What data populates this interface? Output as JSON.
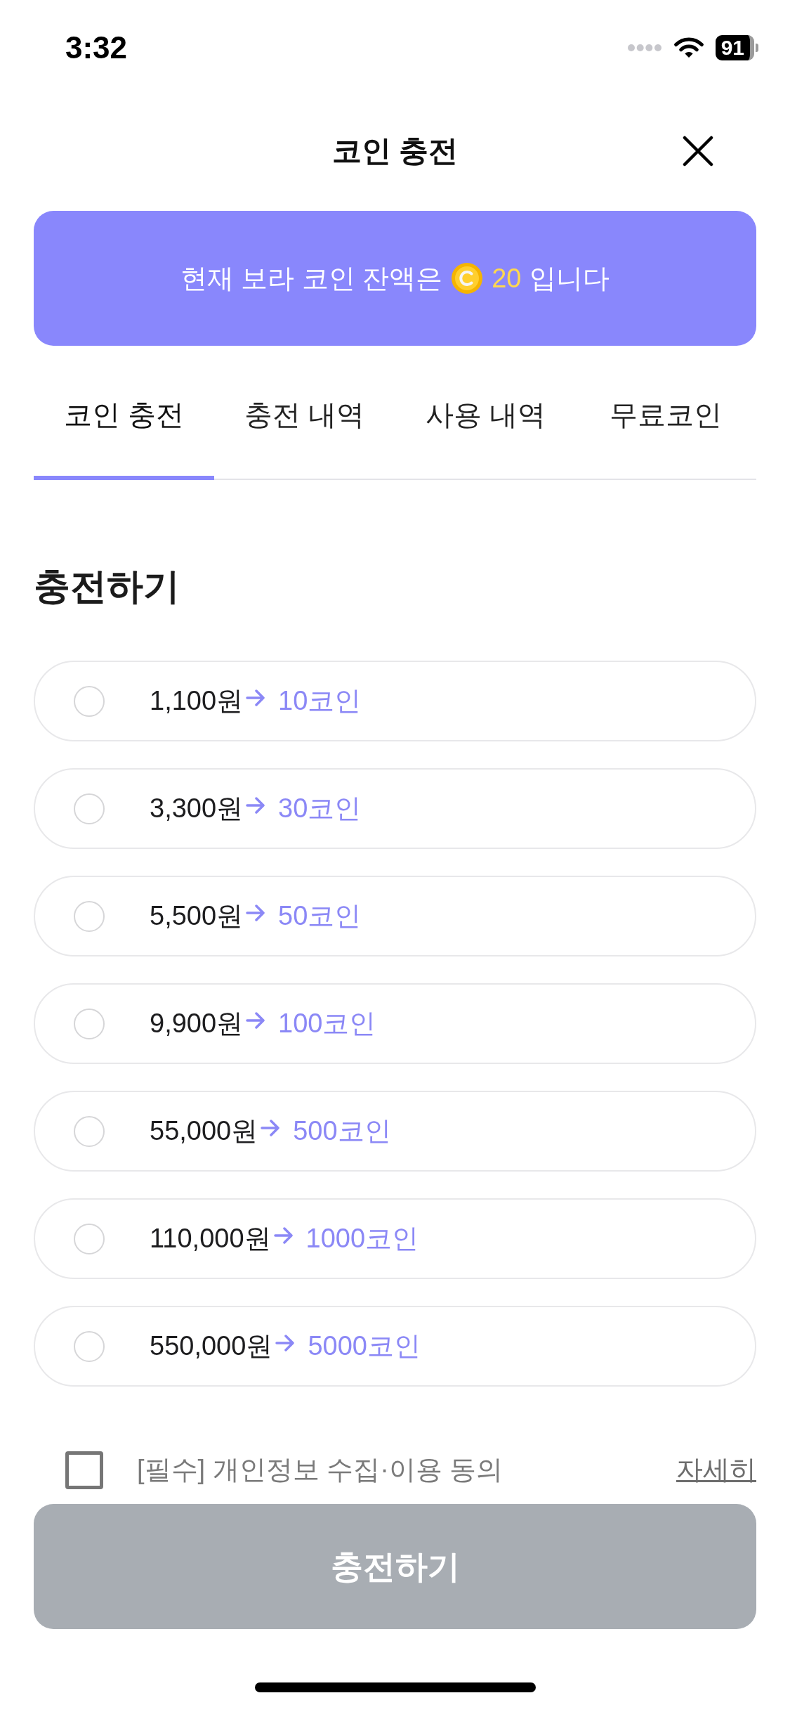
{
  "status_bar": {
    "time": "3:32",
    "battery": "91"
  },
  "header": {
    "title": "코인 충전"
  },
  "balance_banner": {
    "text_before": "현재 보라 코인 잔액은",
    "amount": "20",
    "text_after": "입니다"
  },
  "tabs": [
    {
      "label": "코인 충전",
      "selected": true
    },
    {
      "label": "충전 내역",
      "selected": false
    },
    {
      "label": "사용 내역",
      "selected": false
    },
    {
      "label": "무료코인",
      "selected": false
    }
  ],
  "section_title": "충전하기",
  "options": [
    {
      "price": "1,100원",
      "coins": "10코인",
      "selected": false
    },
    {
      "price": "3,300원",
      "coins": "30코인",
      "selected": false
    },
    {
      "price": "5,500원",
      "coins": "50코인",
      "selected": false
    },
    {
      "price": "9,900원",
      "coins": "100코인",
      "selected": false
    },
    {
      "price": "55,000원",
      "coins": "500코인",
      "selected": false
    },
    {
      "price": "110,000원",
      "coins": "1000코인",
      "selected": false
    },
    {
      "price": "550,000원",
      "coins": "5000코인",
      "selected": false
    }
  ],
  "agreement": {
    "label": "[필수] 개인정보 수집·이용 동의",
    "checked": false,
    "details_link": "자세히"
  },
  "submit_button": {
    "label": "충전하기",
    "disabled": true
  }
}
